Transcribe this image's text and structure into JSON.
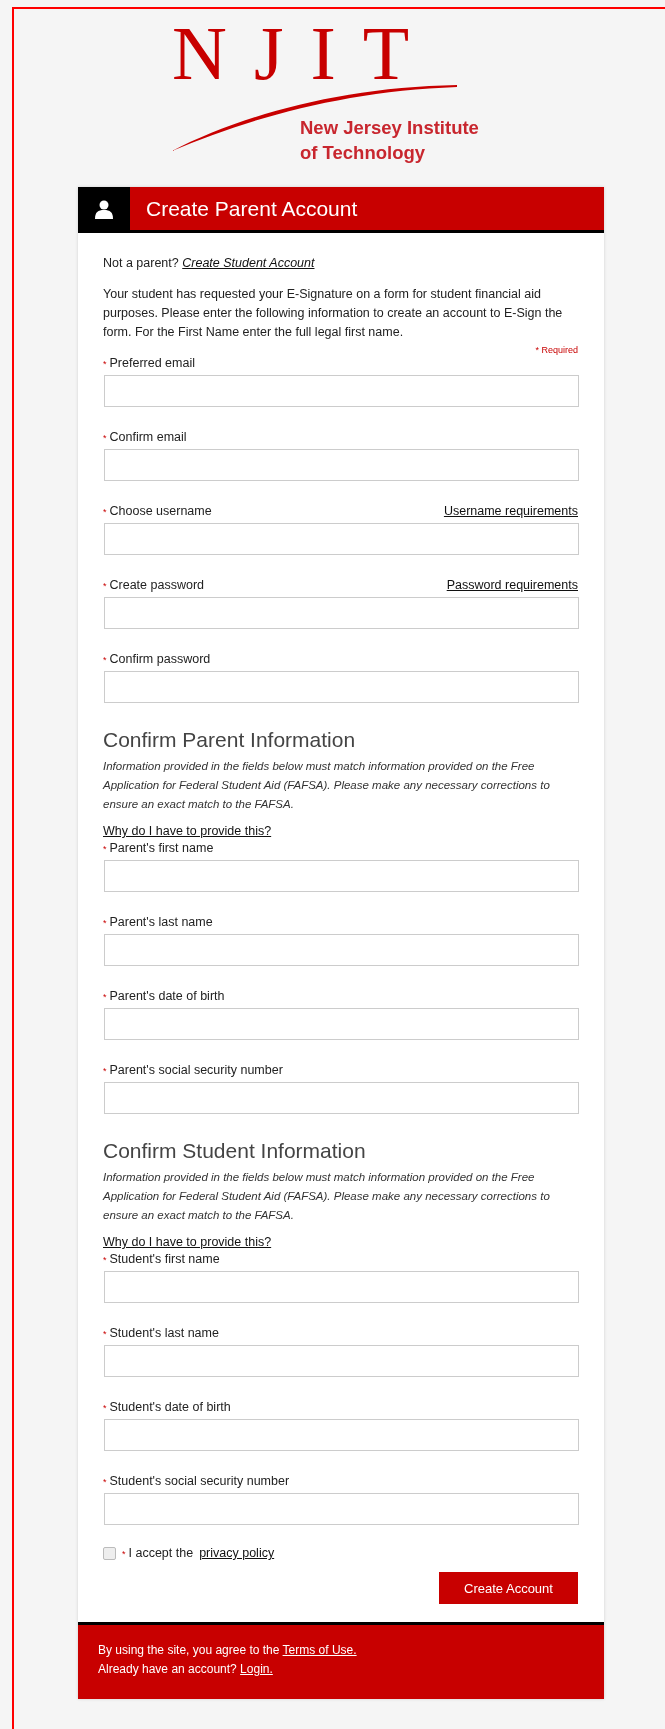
{
  "logo": {
    "letters": "NJIT",
    "subtitle": [
      "New Jersey Institute",
      "of Technology"
    ]
  },
  "header": {
    "title": "Create Parent Account"
  },
  "intro": {
    "question": "Not a parent?",
    "link": "Create Student Account"
  },
  "description": "Your student has requested your E-Signature on a form for student financial aid purposes.  Please enter the following information to create an account to E-Sign the form.  For the First Name enter the full legal first name.",
  "required_note": "* Required",
  "account_fields": [
    {
      "mark": "*",
      "label": "Preferred email"
    },
    {
      "mark": "*",
      "label": "Confirm email"
    },
    {
      "mark": "*",
      "label": "Choose username",
      "help_link": "Username requirements"
    },
    {
      "mark": "*",
      "label": "Create password",
      "help_link": "Password requirements"
    },
    {
      "mark": "*",
      "label": "Confirm password"
    }
  ],
  "sections": [
    {
      "heading": "Confirm Parent Information",
      "note": "Information provided in the fields below must match information provided on the Free Application for Federal Student Aid (FAFSA). Please make any necessary corrections to ensure an exact match to the FAFSA.",
      "link": "Why do I have to provide this?",
      "fields": [
        {
          "mark": "*",
          "label": "Parent's first name"
        },
        {
          "mark": "*",
          "label": "Parent's last name"
        },
        {
          "mark": "*",
          "label": "Parent's date of birth"
        },
        {
          "mark": "*",
          "label": "Parent's social security number"
        }
      ]
    },
    {
      "heading": "Confirm Student Information",
      "note": "Information provided in the fields below must match information provided on the Free Application for Federal Student Aid (FAFSA). Please make any necessary corrections to ensure an exact match to the FAFSA.",
      "link": "Why do I have to provide this?",
      "fields": [
        {
          "mark": "*",
          "label": "Student's first name"
        },
        {
          "mark": "*",
          "label": "Student's last name"
        },
        {
          "mark": "*",
          "label": "Student's date of birth"
        },
        {
          "mark": "*",
          "label": "Student's social security number"
        }
      ]
    }
  ],
  "consent": {
    "checked": false,
    "mark": "*",
    "text": "I accept the",
    "link": "privacy policy"
  },
  "submit": "Create Account",
  "footer": [
    {
      "text": "By using the site, you agree to the",
      "link": "Terms of Use."
    },
    {
      "text": "Already have an account?",
      "link": "Login."
    }
  ]
}
